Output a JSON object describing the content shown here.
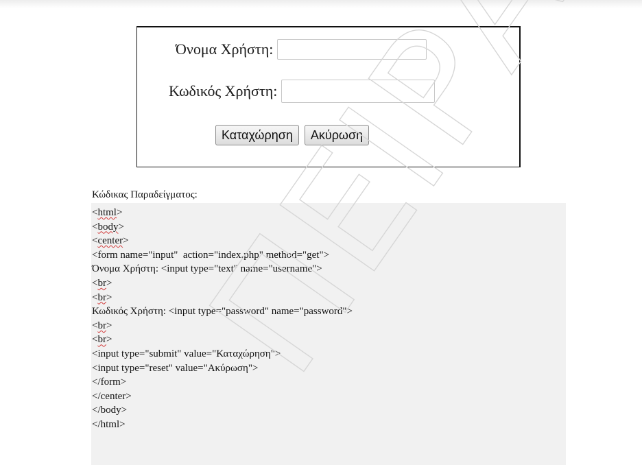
{
  "demo_form": {
    "username_label": "Όνομα Χρήστη:",
    "username_value": "",
    "password_label": "Κωδικός Χρήστη:",
    "password_value": "",
    "submit_label": "Καταχώρηση",
    "reset_label": "Ακύρωση"
  },
  "code_sample": {
    "title": "Κώδικας Παραδείγματος:",
    "lines": [
      {
        "pre": "<",
        "sq": "html",
        "post": ">"
      },
      {
        "pre": "<",
        "sq": "body",
        "post": ">"
      },
      {
        "pre": "<",
        "sq": "center",
        "post": ">"
      },
      {
        "pre": "<form name=\"input\"  action=\"index.php\" method=\"get\">",
        "sq": "",
        "post": ""
      },
      {
        "pre": "Όνομα Χρήστη: <input type=\"text\" name=\"username\">",
        "sq": "",
        "post": ""
      },
      {
        "pre": "<",
        "sq": "br",
        "post": ">"
      },
      {
        "pre": "<",
        "sq": "br",
        "post": ">"
      },
      {
        "pre": "Κωδικός Χρήστη: <input type=\"password\" name=\"password\">",
        "sq": "",
        "post": ""
      },
      {
        "pre": "<",
        "sq": "br",
        "post": ">"
      },
      {
        "pre": "<",
        "sq": "br",
        "post": ">"
      },
      {
        "pre": "<input type=\"submit\" value=\"Καταχώρηση\">",
        "sq": "",
        "post": ""
      },
      {
        "pre": "<input type=\"reset\" value=\"Ακύρωση\">",
        "sq": "",
        "post": ""
      },
      {
        "pre": "</form>",
        "sq": "",
        "post": ""
      },
      {
        "pre": "</center>",
        "sq": "",
        "post": ""
      },
      {
        "pre": "</body>",
        "sq": "",
        "post": ""
      },
      {
        "pre": "</html>",
        "sq": "",
        "post": ""
      }
    ]
  },
  "watermark": "ΠΕΙΡΑΙΩΣ"
}
